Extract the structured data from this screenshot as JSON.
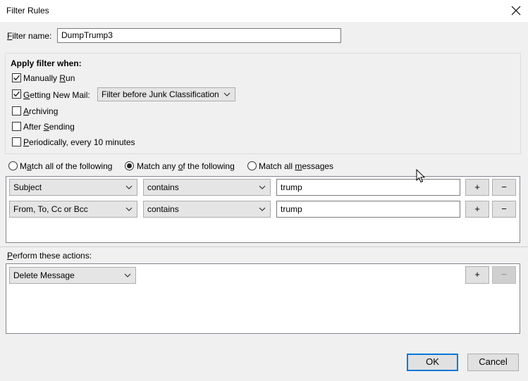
{
  "window": {
    "title": "Filter Rules"
  },
  "filter_name": {
    "label": "Filter name:",
    "value": "DumpTrump3"
  },
  "apply_when": {
    "heading": "Apply filter when:",
    "options": [
      {
        "label": "Manually Run",
        "checked": true
      },
      {
        "label": "Getting New Mail:",
        "checked": true
      },
      {
        "label": "Archiving",
        "checked": false
      },
      {
        "label": "After Sending",
        "checked": false
      },
      {
        "label": "Periodically, every 10 minutes",
        "checked": false
      }
    ],
    "new_mail_select": "Filter before Junk Classification"
  },
  "match": {
    "options": [
      "Match all of the following",
      "Match any of the following",
      "Match all messages"
    ],
    "selected_index": 1
  },
  "rules": [
    {
      "field": "Subject",
      "operator": "contains",
      "value": "trump",
      "add": "+",
      "remove": "−"
    },
    {
      "field": "From, To, Cc or Bcc",
      "operator": "contains",
      "value": "trump",
      "add": "+",
      "remove": "−"
    }
  ],
  "actions": {
    "label": "Perform these actions:",
    "items": [
      {
        "action": "Delete Message",
        "add": "+",
        "remove": "−"
      }
    ]
  },
  "buttons": {
    "ok": "OK",
    "cancel": "Cancel"
  }
}
